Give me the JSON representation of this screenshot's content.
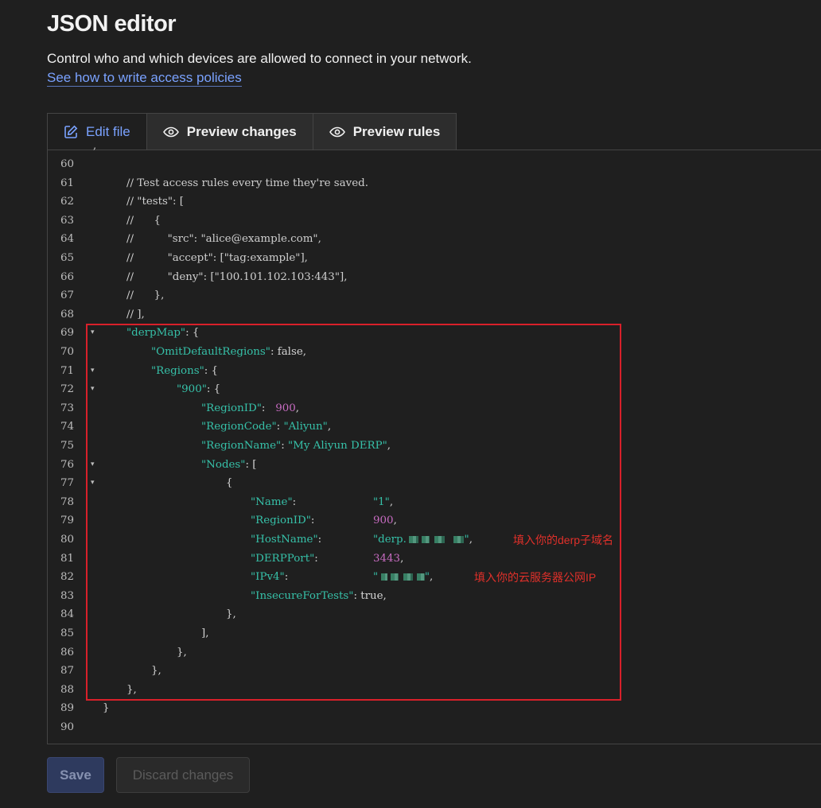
{
  "header": {
    "title": "JSON editor",
    "description": "Control who and which devices are allowed to connect in your network.",
    "docs_link": "See how to write access policies"
  },
  "tabs": [
    {
      "label": "Edit file",
      "icon": "edit-icon",
      "active": true
    },
    {
      "label": "Preview changes",
      "icon": "eye-icon",
      "active": false
    },
    {
      "label": "Preview rules",
      "icon": "eye-icon",
      "active": false
    }
  ],
  "editor": {
    "lines": [
      {
        "n": "60"
      },
      {
        "n": "61",
        "text": "// Test access rules every time they're saved."
      },
      {
        "n": "62",
        "text": "// \"tests\": ["
      },
      {
        "n": "63",
        "text": "//      {"
      },
      {
        "n": "64",
        "text": "//          \"src\": \"alice@example.com\","
      },
      {
        "n": "65",
        "text": "//          \"accept\": [\"tag:example\"],"
      },
      {
        "n": "66",
        "text": "//          \"deny\": [\"100.101.102.103:443\"],"
      },
      {
        "n": "67",
        "text": "//      },"
      },
      {
        "n": "68",
        "text": "// ],"
      },
      {
        "n": "69",
        "key": "\"derpMap\"",
        "rest": ": {"
      },
      {
        "n": "70",
        "key": "\"OmitDefaultRegions\"",
        "rest": ": false,"
      },
      {
        "n": "71",
        "key": "\"Regions\"",
        "rest": ": {"
      },
      {
        "n": "72",
        "key": "\"900\"",
        "rest": ": {"
      },
      {
        "n": "73",
        "key": "\"RegionID\"",
        "rest": ":   ",
        "num": "900",
        "end": ","
      },
      {
        "n": "74",
        "key": "\"RegionCode\"",
        "rest": ": ",
        "str": "\"Aliyun\"",
        "end": ","
      },
      {
        "n": "75",
        "key": "\"RegionName\"",
        "rest": ": ",
        "str": "\"My Aliyun DERP\"",
        "end": ","
      },
      {
        "n": "76",
        "key": "\"Nodes\"",
        "rest": ": ["
      },
      {
        "n": "77",
        "text": "{"
      },
      {
        "n": "78",
        "key": "\"Name\"",
        "rest": ":",
        "str": "\"1\"",
        "end": ","
      },
      {
        "n": "79",
        "key": "\"RegionID\"",
        "rest": ":",
        "num": "900",
        "end": ","
      },
      {
        "n": "80",
        "key": "\"HostName\"",
        "rest": ":",
        "str": "\"derp.",
        "end": "\","
      },
      {
        "n": "81",
        "key": "\"DERPPort\"",
        "rest": ":",
        "num": "3443",
        "end": ","
      },
      {
        "n": "82",
        "key": "\"IPv4\"",
        "rest": ":",
        "str": "\"",
        "end": "\","
      },
      {
        "n": "83",
        "key": "\"InsecureForTests\"",
        "rest": ": true,"
      },
      {
        "n": "84",
        "text": "},"
      },
      {
        "n": "85",
        "text": "],"
      },
      {
        "n": "86",
        "text": "},"
      },
      {
        "n": "87",
        "text": "},"
      },
      {
        "n": "88",
        "text": "},"
      },
      {
        "n": "89",
        "text": "}"
      },
      {
        "n": "90"
      }
    ],
    "annotations": {
      "hostname_note": "填入你的derp子域名",
      "ipv4_note": "填入你的云服务器公网IP"
    }
  },
  "actions": {
    "save_label": "Save",
    "discard_label": "Discard changes"
  },
  "colors": {
    "accent": "#7aa2ff",
    "json_key": "#36c0a8",
    "json_number": "#c66bc0",
    "highlight": "#d8202a"
  }
}
